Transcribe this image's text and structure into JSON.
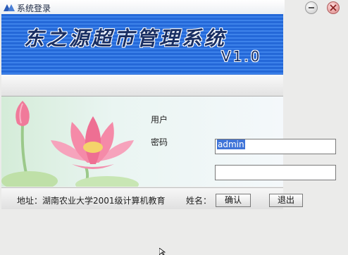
{
  "window": {
    "title": "系统登录"
  },
  "banner": {
    "title": "东之源超市管理系统",
    "version": "V1.0"
  },
  "form": {
    "username_label": "用户",
    "password_label": "密码",
    "username_value": "admin",
    "password_value": ""
  },
  "footer": {
    "address": "地址：湖南农业大学2001级计算机教育",
    "name_label": "姓名：",
    "confirm_label": "确认",
    "exit_label": "退出"
  },
  "colors": {
    "banner_blue": "#2468d8",
    "selection": "#3f74d8"
  },
  "icons": [
    "app-icon",
    "minimize-icon",
    "close-icon",
    "lotus-image",
    "mouse-cursor-icon"
  ]
}
